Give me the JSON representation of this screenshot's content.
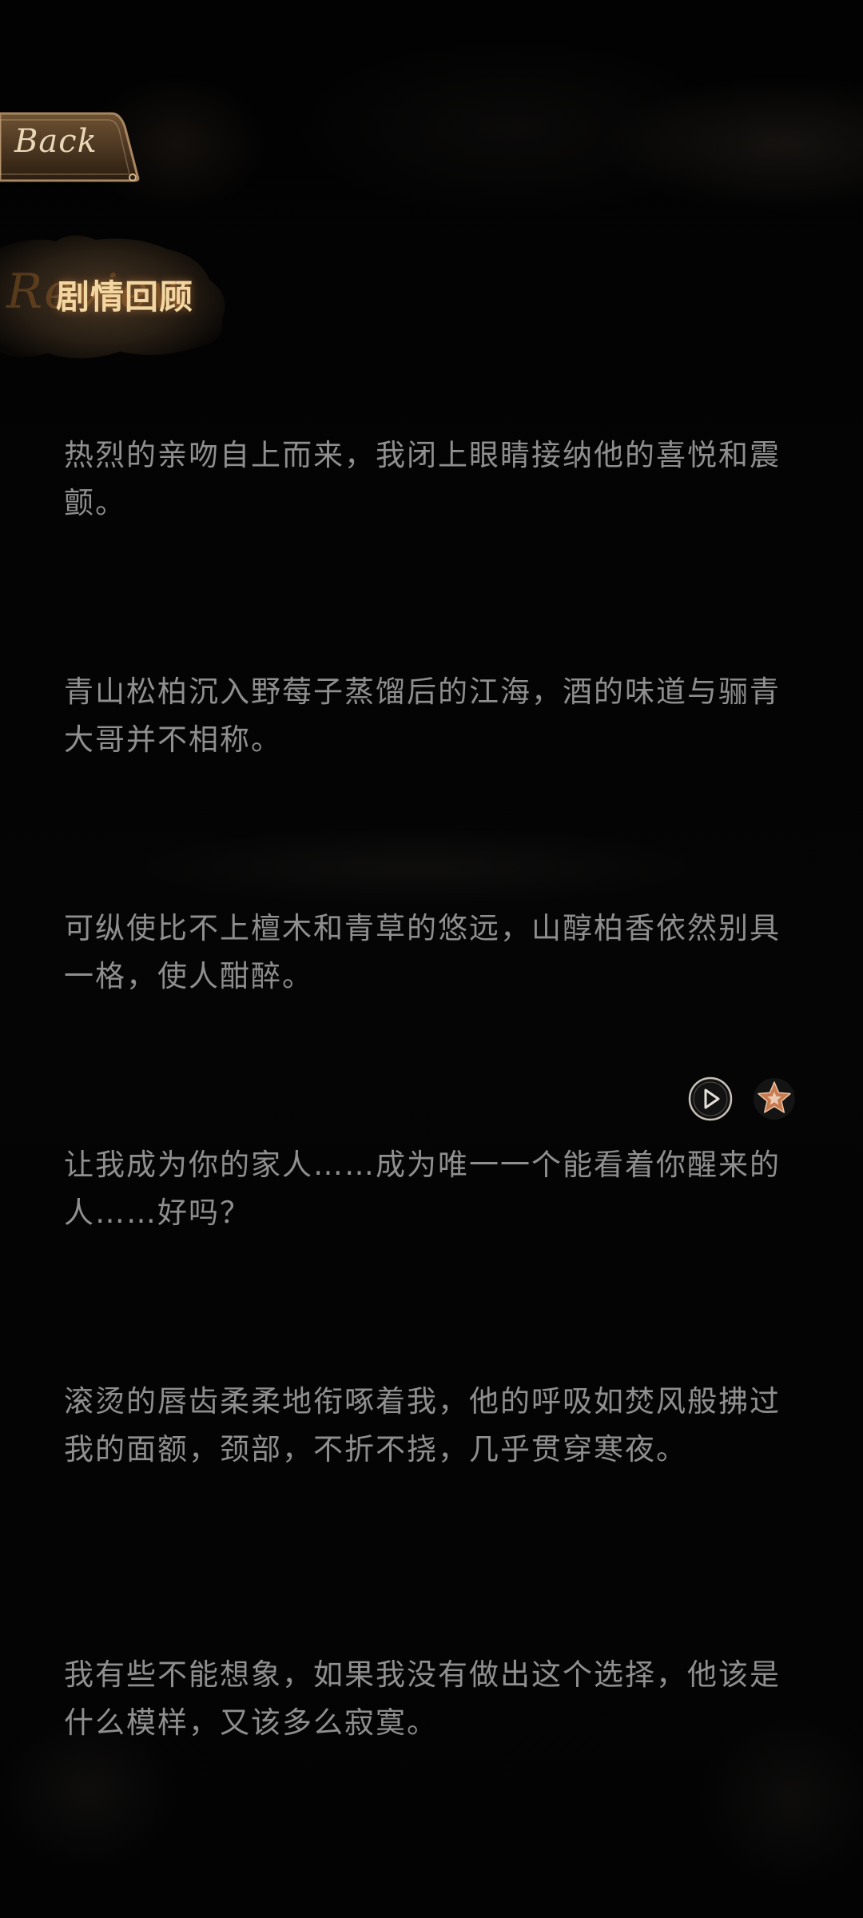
{
  "back_button": {
    "label": "Back"
  },
  "header": {
    "watermark": "Review",
    "title": "剧情回顾"
  },
  "lines": [
    {
      "text": "热烈的亲吻自上而来，我闭上眼睛接纳他的喜悦和震颤。"
    },
    {
      "text": "青山松柏沉入野莓子蒸馏后的江海，酒的味道与骊青大哥并不相称。"
    },
    {
      "text": "可纵使比不上檀木和青草的悠远，山醇柏香依然别具一格，使人酣醉。"
    },
    {
      "text": "让我成为你的家人……成为唯一一个能看着你醒来的人……好吗？"
    },
    {
      "text": "滚烫的唇齿柔柔地衔啄着我，他的呼吸如焚风般拂过我的面额，颈部，不折不挠，几乎贯穿寒夜。"
    },
    {
      "text": "我有些不能想象，如果我没有做出这个选择，他该是什么模样，又该多么寂寞。"
    }
  ],
  "line_actions": {
    "play_icon": "play-circle-icon",
    "favorite_icon": "star-icon"
  },
  "colors": {
    "background": "#030303",
    "text": "#8f8f8f",
    "accent_gold": "#e9d7b7",
    "favorite_accent": "#c97a4e"
  }
}
